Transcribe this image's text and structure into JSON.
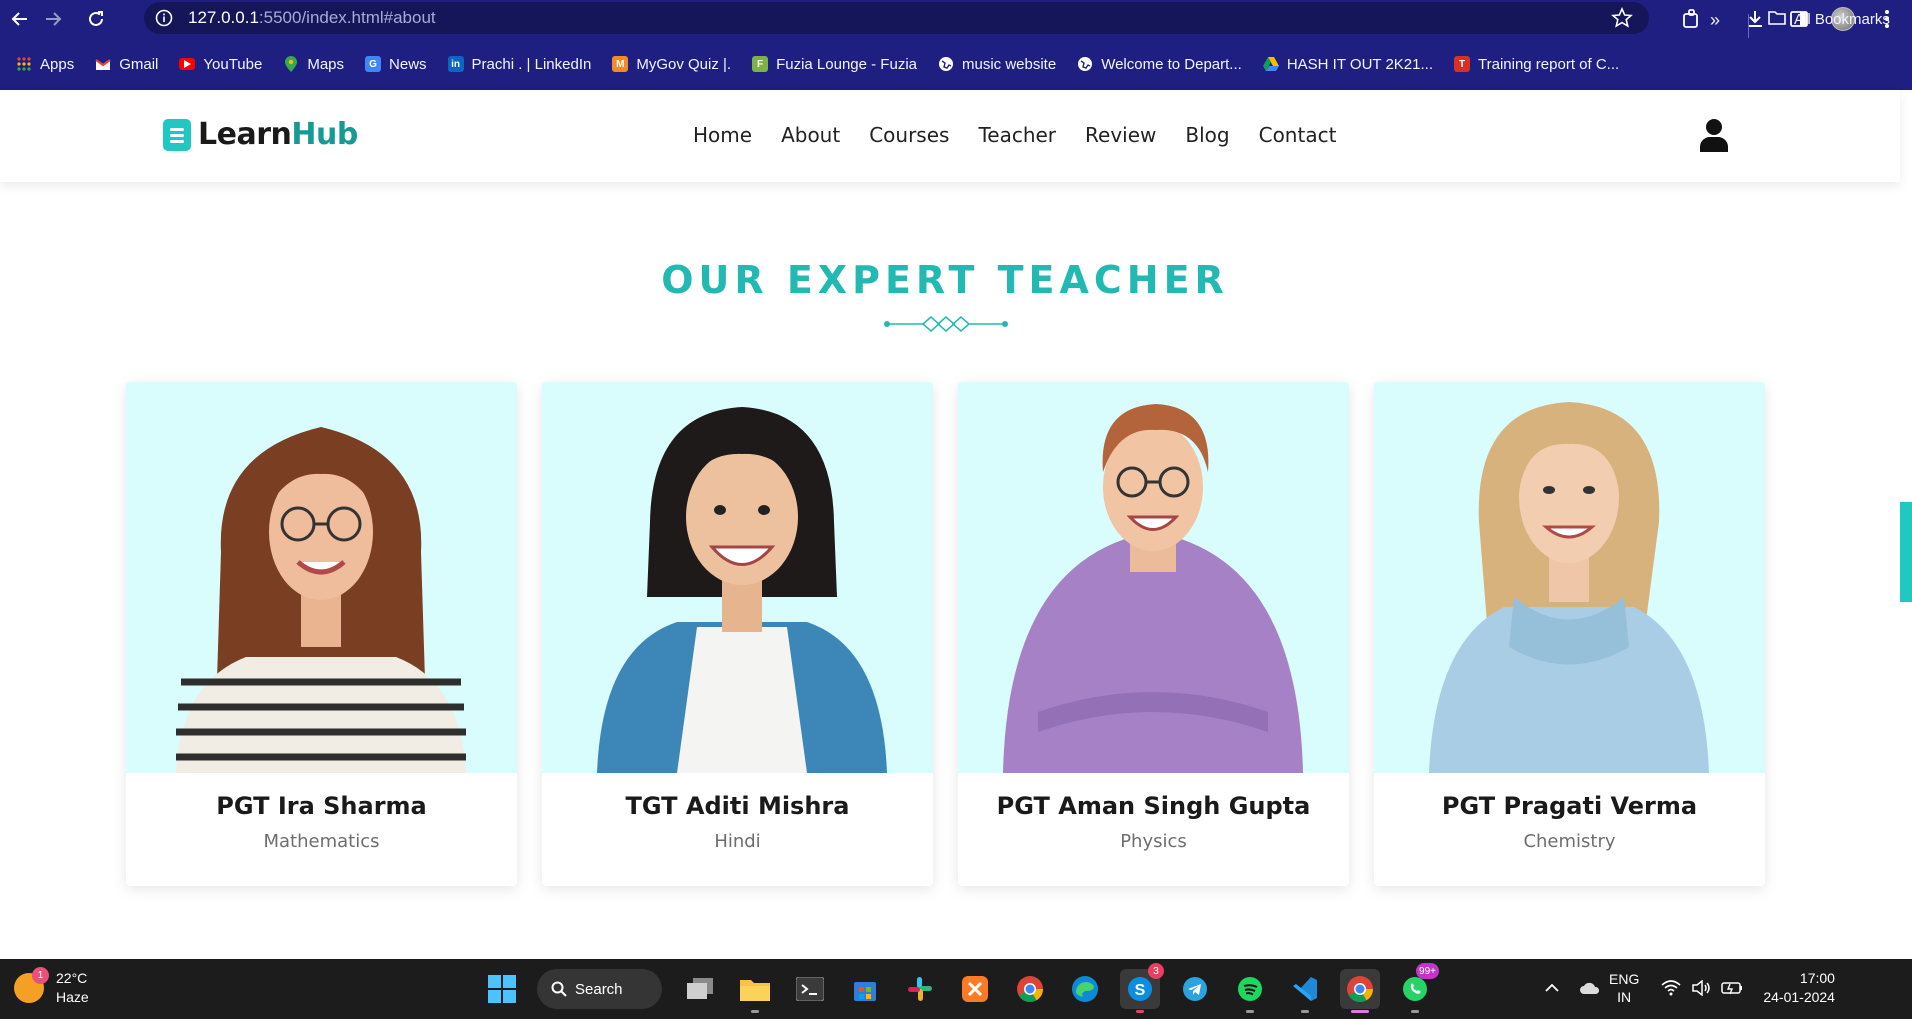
{
  "browser": {
    "url_host": "127.0.0.1",
    "url_path": ":5500/index.html#about",
    "bookmarks": [
      {
        "label": "Apps",
        "color": "#4285f4"
      },
      {
        "label": "Gmail",
        "color": "#ea4335"
      },
      {
        "label": "YouTube",
        "color": "#ff0000"
      },
      {
        "label": "Maps",
        "color": "#34a853"
      },
      {
        "label": "News",
        "color": "#4285f4"
      },
      {
        "label": "Prachi . | LinkedIn",
        "color": "#0a66c2"
      },
      {
        "label": "MyGov Quiz |.",
        "color": "#f28b25"
      },
      {
        "label": "Fuzia Lounge - Fuzia",
        "color": "#7cb342"
      },
      {
        "label": "music website",
        "color": "#5f6368"
      },
      {
        "label": "Welcome to Depart...",
        "color": "#5f6368"
      },
      {
        "label": "HASH IT OUT 2K21...",
        "color": "#0f9d58"
      },
      {
        "label": "Training report of C...",
        "color": "#d93025"
      }
    ],
    "all_bookmarks": "All Bookmarks"
  },
  "site": {
    "logo_part1": "Learn",
    "logo_part2": "Hub",
    "nav": [
      "Home",
      "About",
      "Courses",
      "Teacher",
      "Review",
      "Blog",
      "Contact"
    ],
    "accent_color": "#23b9b3"
  },
  "section": {
    "title": "OUR EXPERT TEACHER"
  },
  "teachers": [
    {
      "name": "PGT Ira Sharma",
      "subject": "Mathematics"
    },
    {
      "name": "TGT Aditi Mishra",
      "subject": "Hindi"
    },
    {
      "name": "PGT Aman Singh Gupta",
      "subject": "Physics"
    },
    {
      "name": "PGT Pragati Verma",
      "subject": "Chemistry"
    }
  ],
  "taskbar": {
    "temperature": "22°C",
    "weather": "Haze",
    "weather_badge": "1",
    "search_label": "Search",
    "skype_badge": "3",
    "whatsapp_badge": "99+",
    "lang": "ENG",
    "region": "IN",
    "time": "17:00",
    "date": "24-01-2024"
  }
}
